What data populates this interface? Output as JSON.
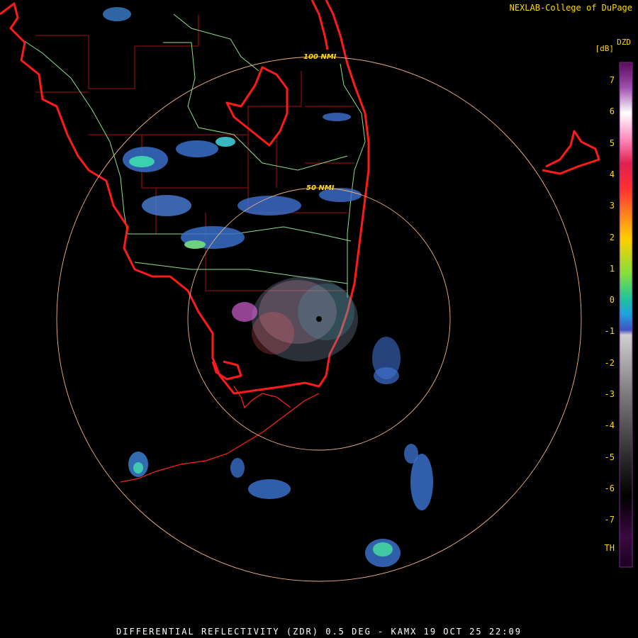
{
  "header": {
    "credit": "NEXLAB-College of DuPage"
  },
  "footer": {
    "product_line": "DIFFERENTIAL REFLECTIVITY (ZDR) 0.5 DEG - KAMX 19 OCT 25 22:09"
  },
  "range_rings": {
    "inner_label": "50 NMI",
    "outer_label": "100 NMI"
  },
  "color_scale": {
    "product": "DZD",
    "units": "[dB]",
    "labels": [
      "7",
      "6",
      "5",
      "4",
      "3",
      "2",
      "1",
      "0",
      "-1",
      "-2",
      "-3",
      "-4",
      "-5",
      "-6",
      "-7",
      "TH"
    ]
  },
  "colors": {
    "background": "#000000",
    "coastline": "#ff1a1a",
    "county_lines": "#b01010",
    "highways": "#8adf8a",
    "ring": "#f0b080",
    "text": "#ffd800",
    "footer_text": "#ffffff"
  }
}
